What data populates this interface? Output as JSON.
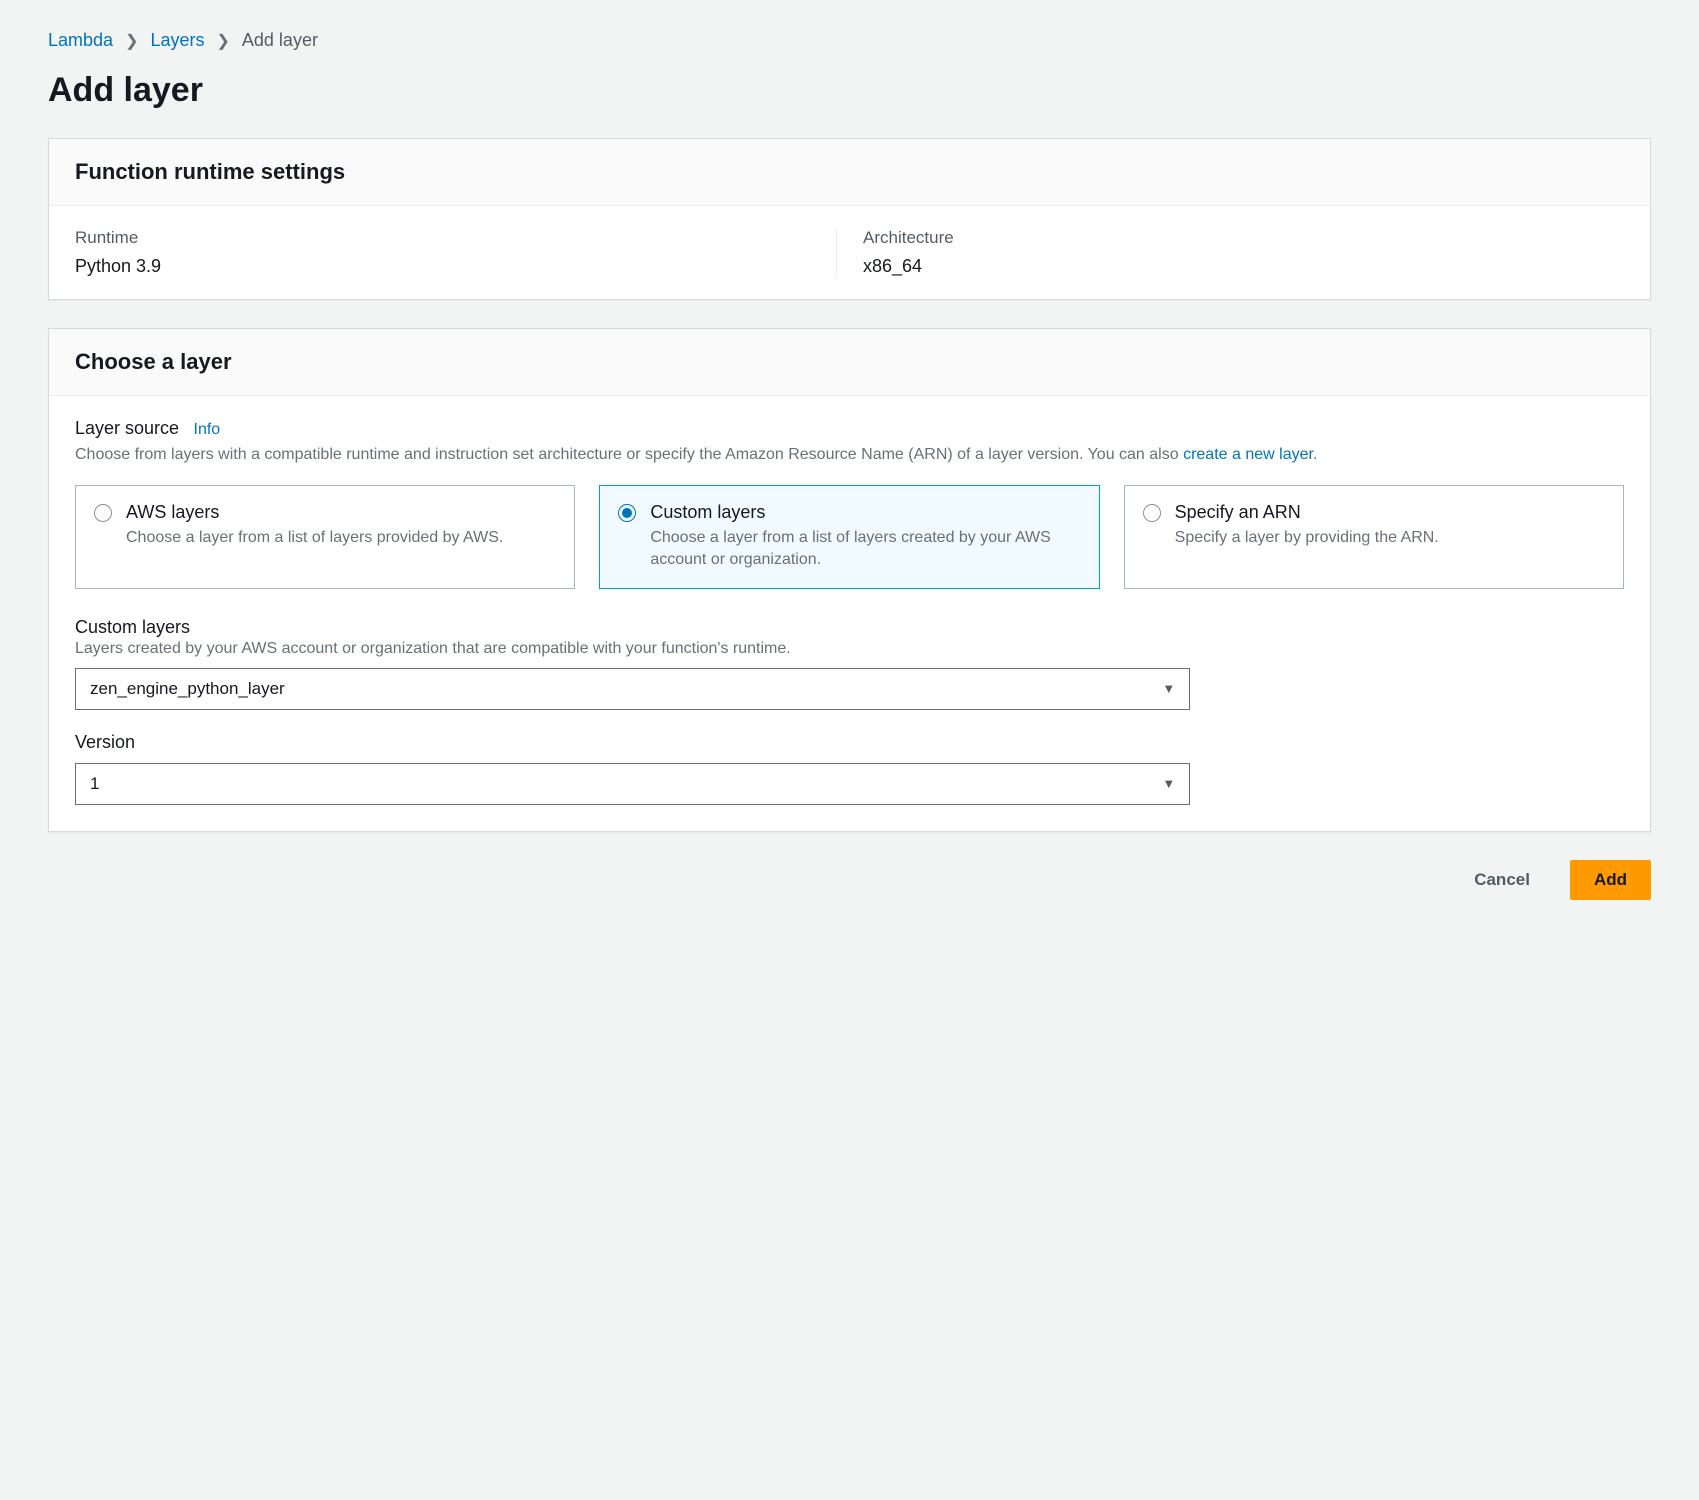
{
  "breadcrumb": {
    "items": [
      {
        "label": "Lambda",
        "link": true
      },
      {
        "label": "Layers",
        "link": true
      },
      {
        "label": "Add layer",
        "link": false
      }
    ]
  },
  "page_title": "Add layer",
  "runtime_panel": {
    "heading": "Function runtime settings",
    "runtime_label": "Runtime",
    "runtime_value": "Python 3.9",
    "arch_label": "Architecture",
    "arch_value": "x86_64"
  },
  "choose_panel": {
    "heading": "Choose a layer",
    "source_label": "Layer source",
    "info_label": "Info",
    "source_help_pre": "Choose from layers with a compatible runtime and instruction set architecture or specify the Amazon Resource Name (ARN) of a layer version. You can also ",
    "source_help_link": "create a new layer",
    "source_help_post": ".",
    "tiles": [
      {
        "title": "AWS layers",
        "desc": "Choose a layer from a list of layers provided by AWS.",
        "selected": false
      },
      {
        "title": "Custom layers",
        "desc": "Choose a layer from a list of layers created by your AWS account or organization.",
        "selected": true
      },
      {
        "title": "Specify an ARN",
        "desc": "Specify a layer by providing the ARN.",
        "selected": false
      }
    ],
    "custom_layers": {
      "label": "Custom layers",
      "help": "Layers created by your AWS account or organization that are compatible with your function's runtime.",
      "selected": "zen_engine_python_layer"
    },
    "version": {
      "label": "Version",
      "selected": "1"
    }
  },
  "actions": {
    "cancel": "Cancel",
    "add": "Add"
  }
}
